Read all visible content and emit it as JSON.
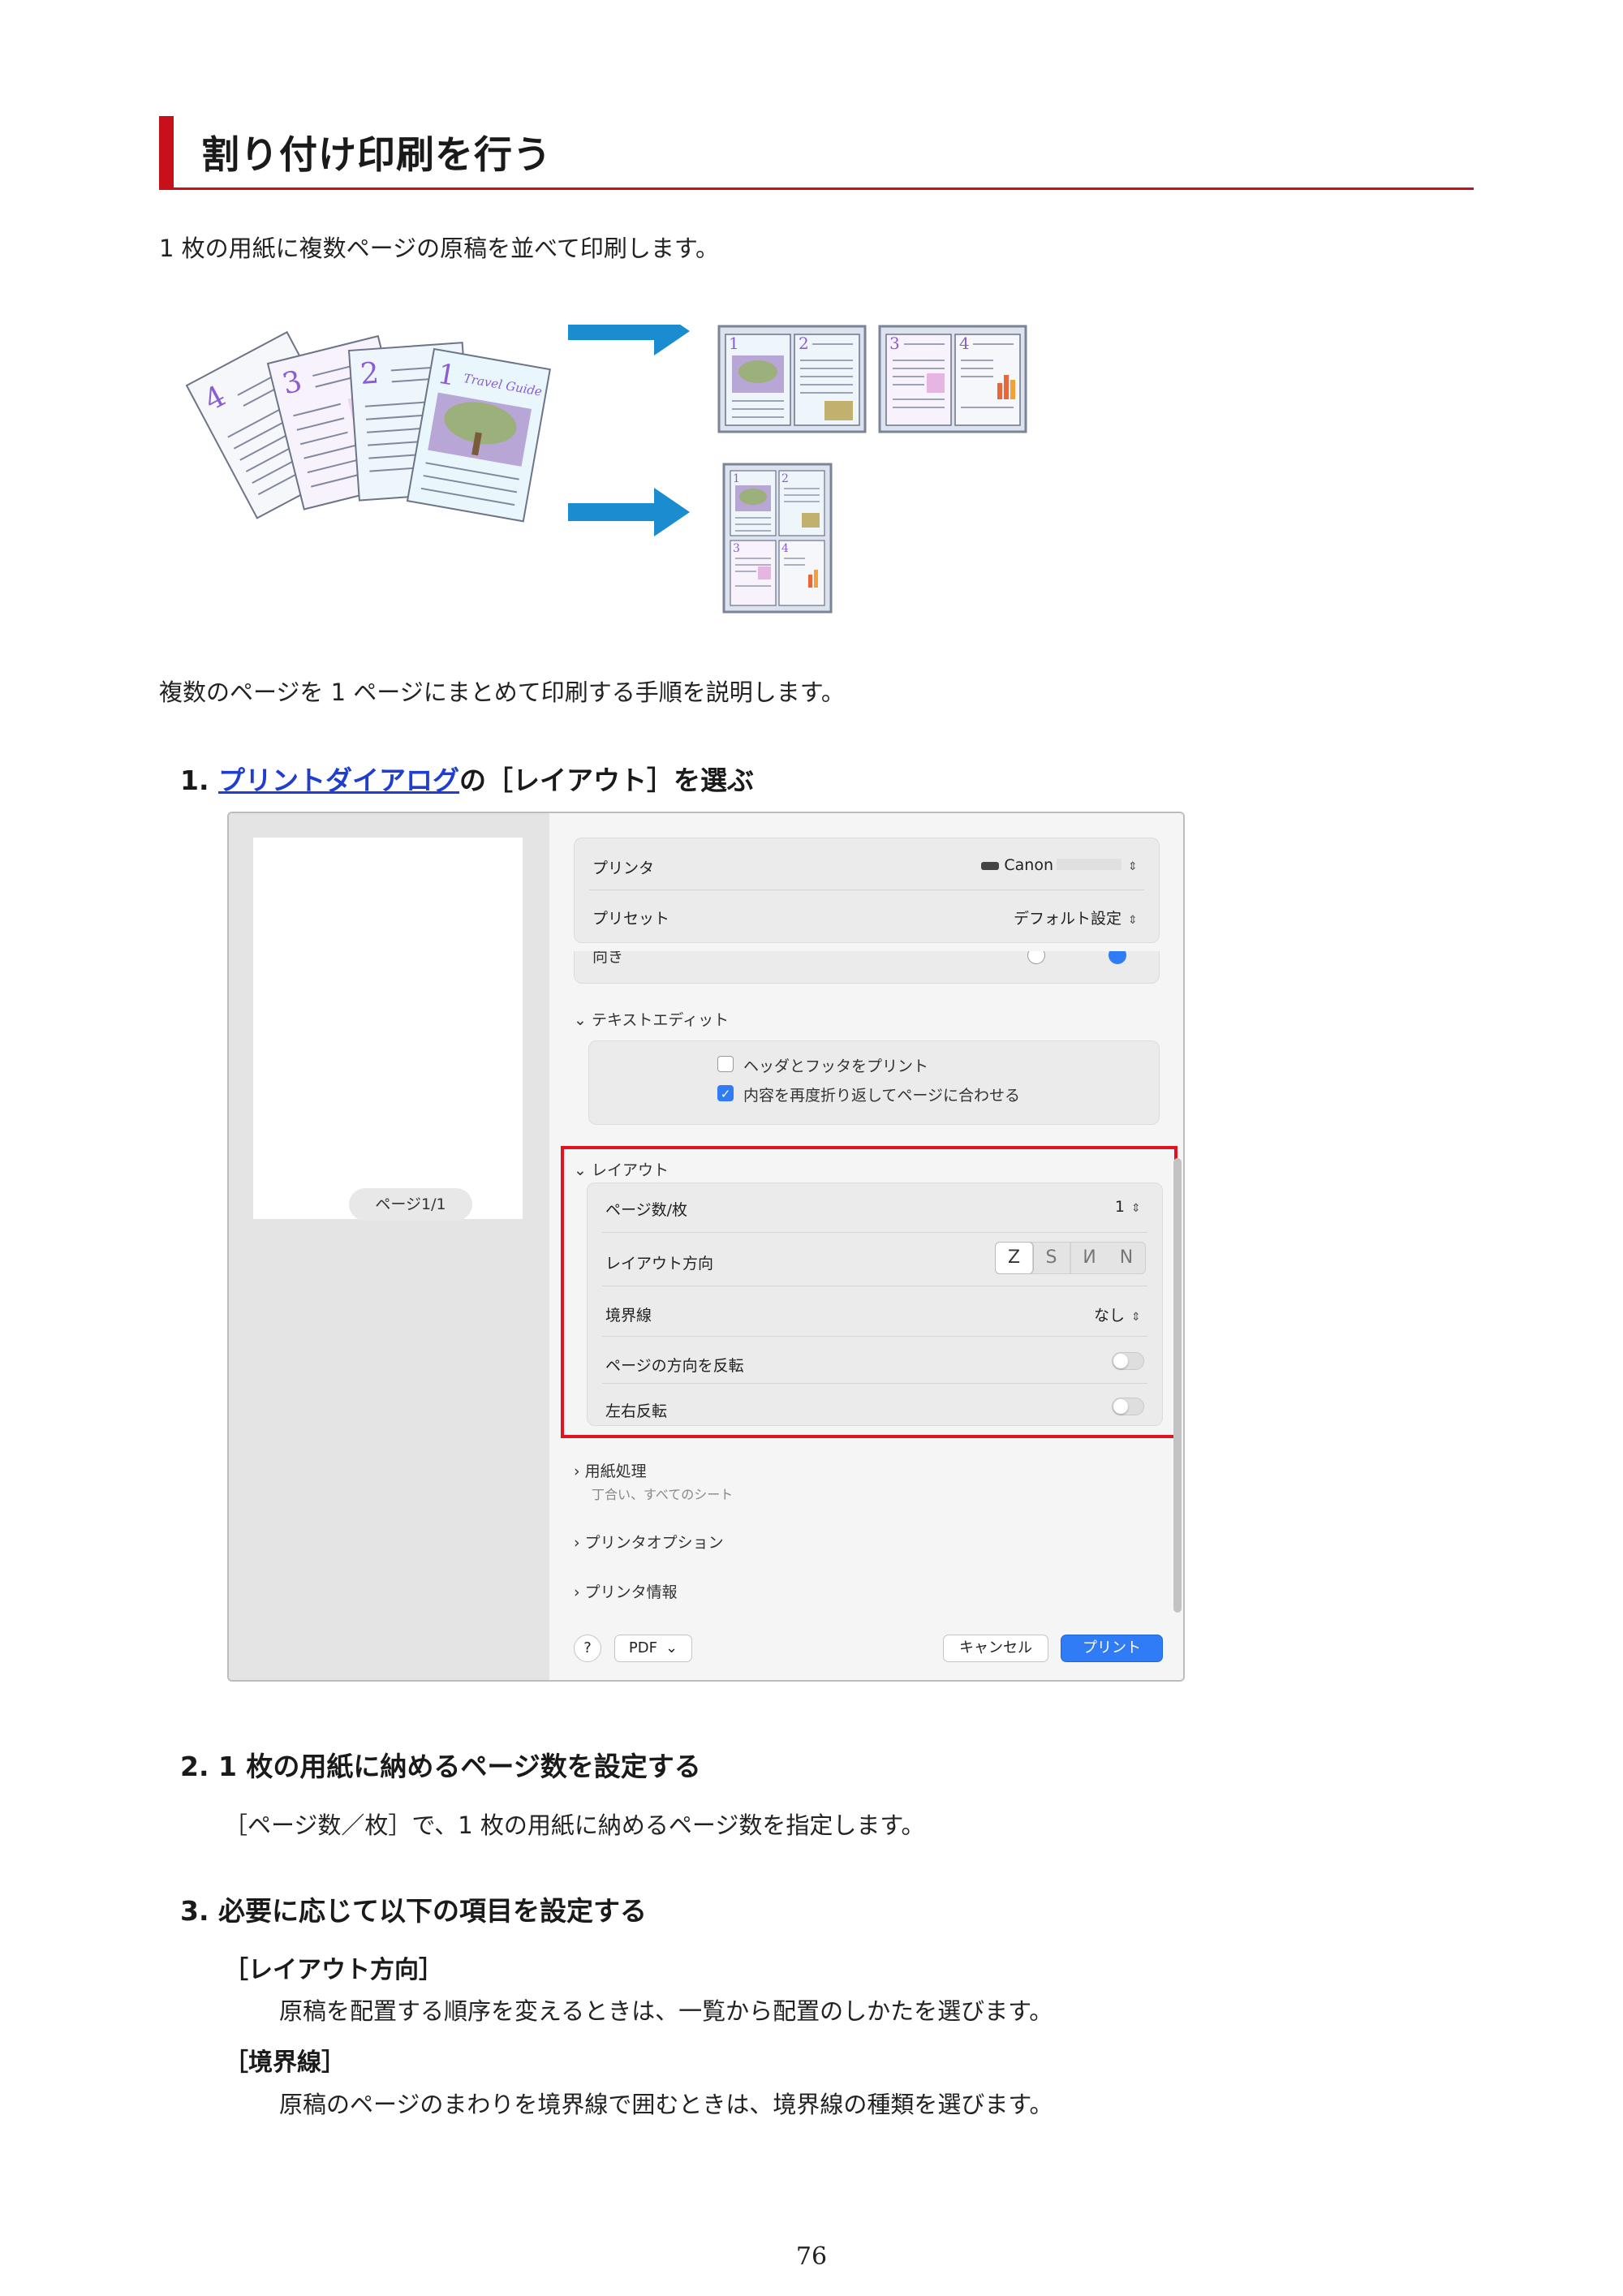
{
  "title": "割り付け印刷を行う",
  "intro": "1 枚の用紙に複数ページの原稿を並べて印刷します。",
  "illustration": {
    "source_numbers": [
      "4",
      "3",
      "2",
      "1"
    ],
    "cover_text": "Travel Guide",
    "result_2up": [
      "1",
      "2",
      "3",
      "4"
    ],
    "result_4up": [
      "1",
      "2",
      "3",
      "4"
    ]
  },
  "procedure_intro": "複数のページを 1 ページにまとめて印刷する手順を説明します。",
  "step1": {
    "number": "1.",
    "link": "プリントダイアログ",
    "rest": "の［レイアウト］を選ぶ"
  },
  "dialog": {
    "page_indicator": "ページ1/1",
    "printer_label": "プリンタ",
    "printer_value": "Canon",
    "preset_label": "プリセット",
    "preset_value": "デフォルト設定",
    "orientation_cut": "向き",
    "text_editor_section": "テキストエディット",
    "checkbox1_label": "ヘッダとフッタをプリント",
    "checkbox2_label": "内容を再度折り返してページに合わせる",
    "layout_section": "レイアウト",
    "pages_per_sheet_label": "ページ数/枚",
    "pages_per_sheet_value": "1",
    "layout_direction_label": "レイアウト方向",
    "layout_direction_options": [
      "Z",
      "S",
      "N",
      "N"
    ],
    "border_label": "境界線",
    "border_value": "なし",
    "flip_page_label": "ページの方向を反転",
    "mirror_label": "左右反転",
    "paper_handling_section": "用紙処理",
    "paper_handling_sub": "丁合い、すべてのシート",
    "printer_options_section": "プリンタオプション",
    "printer_info_section": "プリンタ情報",
    "help_button": "?",
    "pdf_button": "PDF",
    "cancel_button": "キャンセル",
    "print_button": "プリント"
  },
  "step2": {
    "heading": "2.  1 枚の用紙に納めるページ数を設定する",
    "body": "［ページ数／枚］で、1 枚の用紙に納めるページ数を指定します。"
  },
  "step3": {
    "heading": "3.  必要に応じて以下の項目を設定する",
    "item1_label": "［レイアウト方向］",
    "item1_body": "原稿を配置する順序を変えるときは、一覧から配置のしかたを選びます。",
    "item2_label": "［境界線］",
    "item2_body": "原稿のページのまわりを境界線で囲むときは、境界線の種類を選びます。"
  },
  "page_number": "76",
  "colors": {
    "accent_red": "#c8101a",
    "link_blue": "#1f3ecf",
    "arrow_blue": "#1c8cd0",
    "highlight_red": "#e0141f",
    "button_blue": "#2f7cf6"
  }
}
